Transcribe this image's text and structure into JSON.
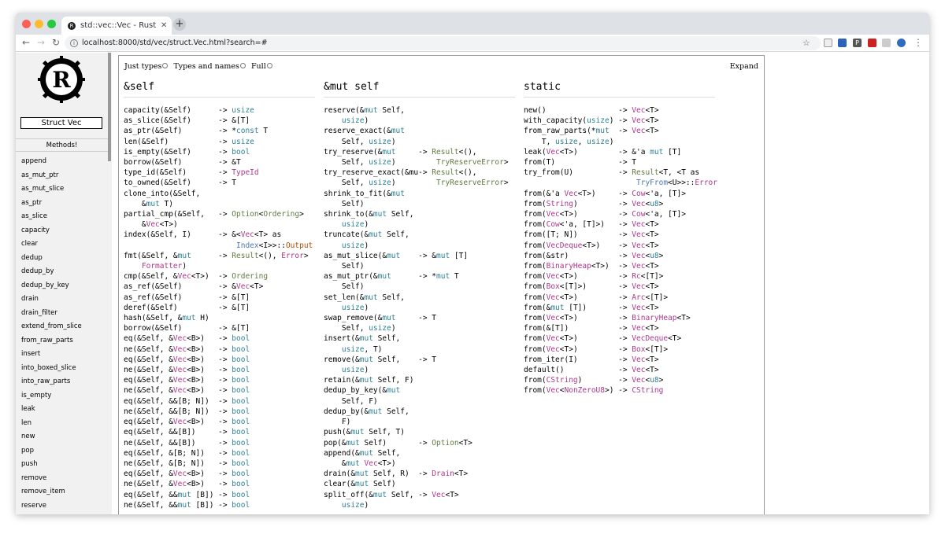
{
  "browser": {
    "tab_title": "std::vec::Vec - Rust",
    "tab_favicon": "R",
    "url": "localhost:8000/std/vec/struct.Vec.html?search=#"
  },
  "sidebar": {
    "title": "Struct Vec",
    "methods_heading": "Methods!",
    "items": [
      "append",
      "as_mut_ptr",
      "as_mut_slice",
      "as_ptr",
      "as_slice",
      "capacity",
      "clear",
      "dedup",
      "dedup_by",
      "dedup_by_key",
      "drain",
      "drain_filter",
      "extend_from_slice",
      "from_raw_parts",
      "insert",
      "into_boxed_slice",
      "into_raw_parts",
      "is_empty",
      "leak",
      "len",
      "new",
      "pop",
      "push",
      "remove",
      "remove_item",
      "reserve"
    ]
  },
  "filters": {
    "just_types": "Just types",
    "types_and_names": "Types and names",
    "full": "Full"
  },
  "expand_label": "Expand",
  "columns": [
    {
      "heading": "&self",
      "rows": [
        "capacity(&Self)      -> usize",
        "as_slice(&Self)      -> &[T]",
        "as_ptr(&Self)        -> *const T",
        "len(&Self)           -> usize",
        "is_empty(&Self)      -> bool",
        "borrow(&Self)        -> &T",
        "type_id(&Self)       -> TypeId",
        "to_owned(&Self)      -> T",
        "clone_into(&Self,",
        "    &mut T)",
        "partial_cmp(&Self,   -> Option<Ordering>",
        "    &Vec<T>)",
        "index(&Self, I)      -> &<Vec<T> as",
        "                         Index<I>>::Output",
        "fmt(&Self, &mut      -> Result<(), Error>",
        "    Formatter)",
        "cmp(&Self, &Vec<T>)  -> Ordering",
        "as_ref(&Self)        -> &Vec<T>",
        "as_ref(&Self)        -> &[T]",
        "deref(&Self)         -> &[T]",
        "hash(&Self, &mut H)",
        "borrow(&Self)        -> &[T]",
        "eq(&Self, &Vec<B>)   -> bool",
        "ne(&Self, &Vec<B>)   -> bool",
        "eq(&Self, &Vec<B>)   -> bool",
        "ne(&Self, &Vec<B>)   -> bool",
        "eq(&Self, &Vec<B>)   -> bool",
        "ne(&Self, &Vec<B>)   -> bool",
        "eq(&Self, &&[B; N])  -> bool",
        "ne(&Self, &&[B; N])  -> bool",
        "eq(&Self, &Vec<B>)   -> bool",
        "eq(&Self, &&[B])     -> bool",
        "ne(&Self, &&[B])     -> bool",
        "eq(&Self, &[B; N])   -> bool",
        "ne(&Self, &[B; N])   -> bool",
        "eq(&Self, &Vec<B>)   -> bool",
        "ne(&Self, &Vec<B>)   -> bool",
        "eq(&Self, &&mut [B]) -> bool",
        "ne(&Self, &&mut [B]) -> bool"
      ]
    },
    {
      "heading": "&mut self",
      "rows": [
        "reserve(&mut Self,",
        "    usize)",
        "reserve_exact(&mut",
        "    Self, usize)",
        "try_reserve(&mut     -> Result<(),",
        "    Self, usize)         TryReserveError>",
        "try_reserve_exact(&mu-> Result<(),",
        "    Self, usize)         TryReserveError>",
        "shrink_to_fit(&mut",
        "    Self)",
        "shrink_to(&mut Self,",
        "    usize)",
        "truncate(&mut Self,",
        "    usize)",
        "as_mut_slice(&mut    -> &mut [T]",
        "    Self)",
        "as_mut_ptr(&mut      -> *mut T",
        "    Self)",
        "set_len(&mut Self,",
        "    usize)",
        "swap_remove(&mut     -> T",
        "    Self, usize)",
        "insert(&mut Self,",
        "    usize, T)",
        "remove(&mut Self,    -> T",
        "    usize)",
        "retain(&mut Self, F)",
        "dedup_by_key(&mut",
        "    Self, F)",
        "dedup_by(&mut Self,",
        "    F)",
        "push(&mut Self, T)",
        "pop(&mut Self)       -> Option<T>",
        "append(&mut Self,",
        "    &mut Vec<T>)",
        "drain(&mut Self, R)  -> Drain<T>",
        "clear(&mut Self)",
        "split_off(&mut Self, -> Vec<T>",
        "    usize)"
      ]
    },
    {
      "heading": "static",
      "rows": [
        "new()                -> Vec<T>",
        "with_capacity(usize) -> Vec<T>",
        "from_raw_parts(*mut  -> Vec<T>",
        "    T, usize, usize)",
        "leak(Vec<T>)         -> &'a mut [T]",
        "from(T)              -> T",
        "try_from(U)          -> Result<T, <T as",
        "                         TryFrom<U>>::Error",
        "from(&'a Vec<T>)     -> Cow<'a, [T]>",
        "from(String)         -> Vec<u8>",
        "from(Vec<T>)         -> Cow<'a, [T]>",
        "from(Cow<'a, [T]>)   -> Vec<T>",
        "from([T; N])         -> Vec<T>",
        "from(VecDeque<T>)    -> Vec<T>",
        "from(&str)           -> Vec<u8>",
        "from(BinaryHeap<T>)  -> Vec<T>",
        "from(Vec<T>)         -> Rc<[T]>",
        "from(Box<[T]>)       -> Vec<T>",
        "from(Vec<T>)         -> Arc<[T]>",
        "from(&mut [T])       -> Vec<T>",
        "from(Vec<T>)         -> BinaryHeap<T>",
        "from(&[T])           -> Vec<T>",
        "from(Vec<T>)         -> VecDeque<T>",
        "from(Vec<T>)         -> Box<[T]>",
        "from_iter(I)         -> Vec<T>",
        "default()            -> Vec<T>",
        "from(CString)        -> Vec<u8>",
        "from(Vec<NonZeroU8>) -> CString"
      ]
    }
  ]
}
